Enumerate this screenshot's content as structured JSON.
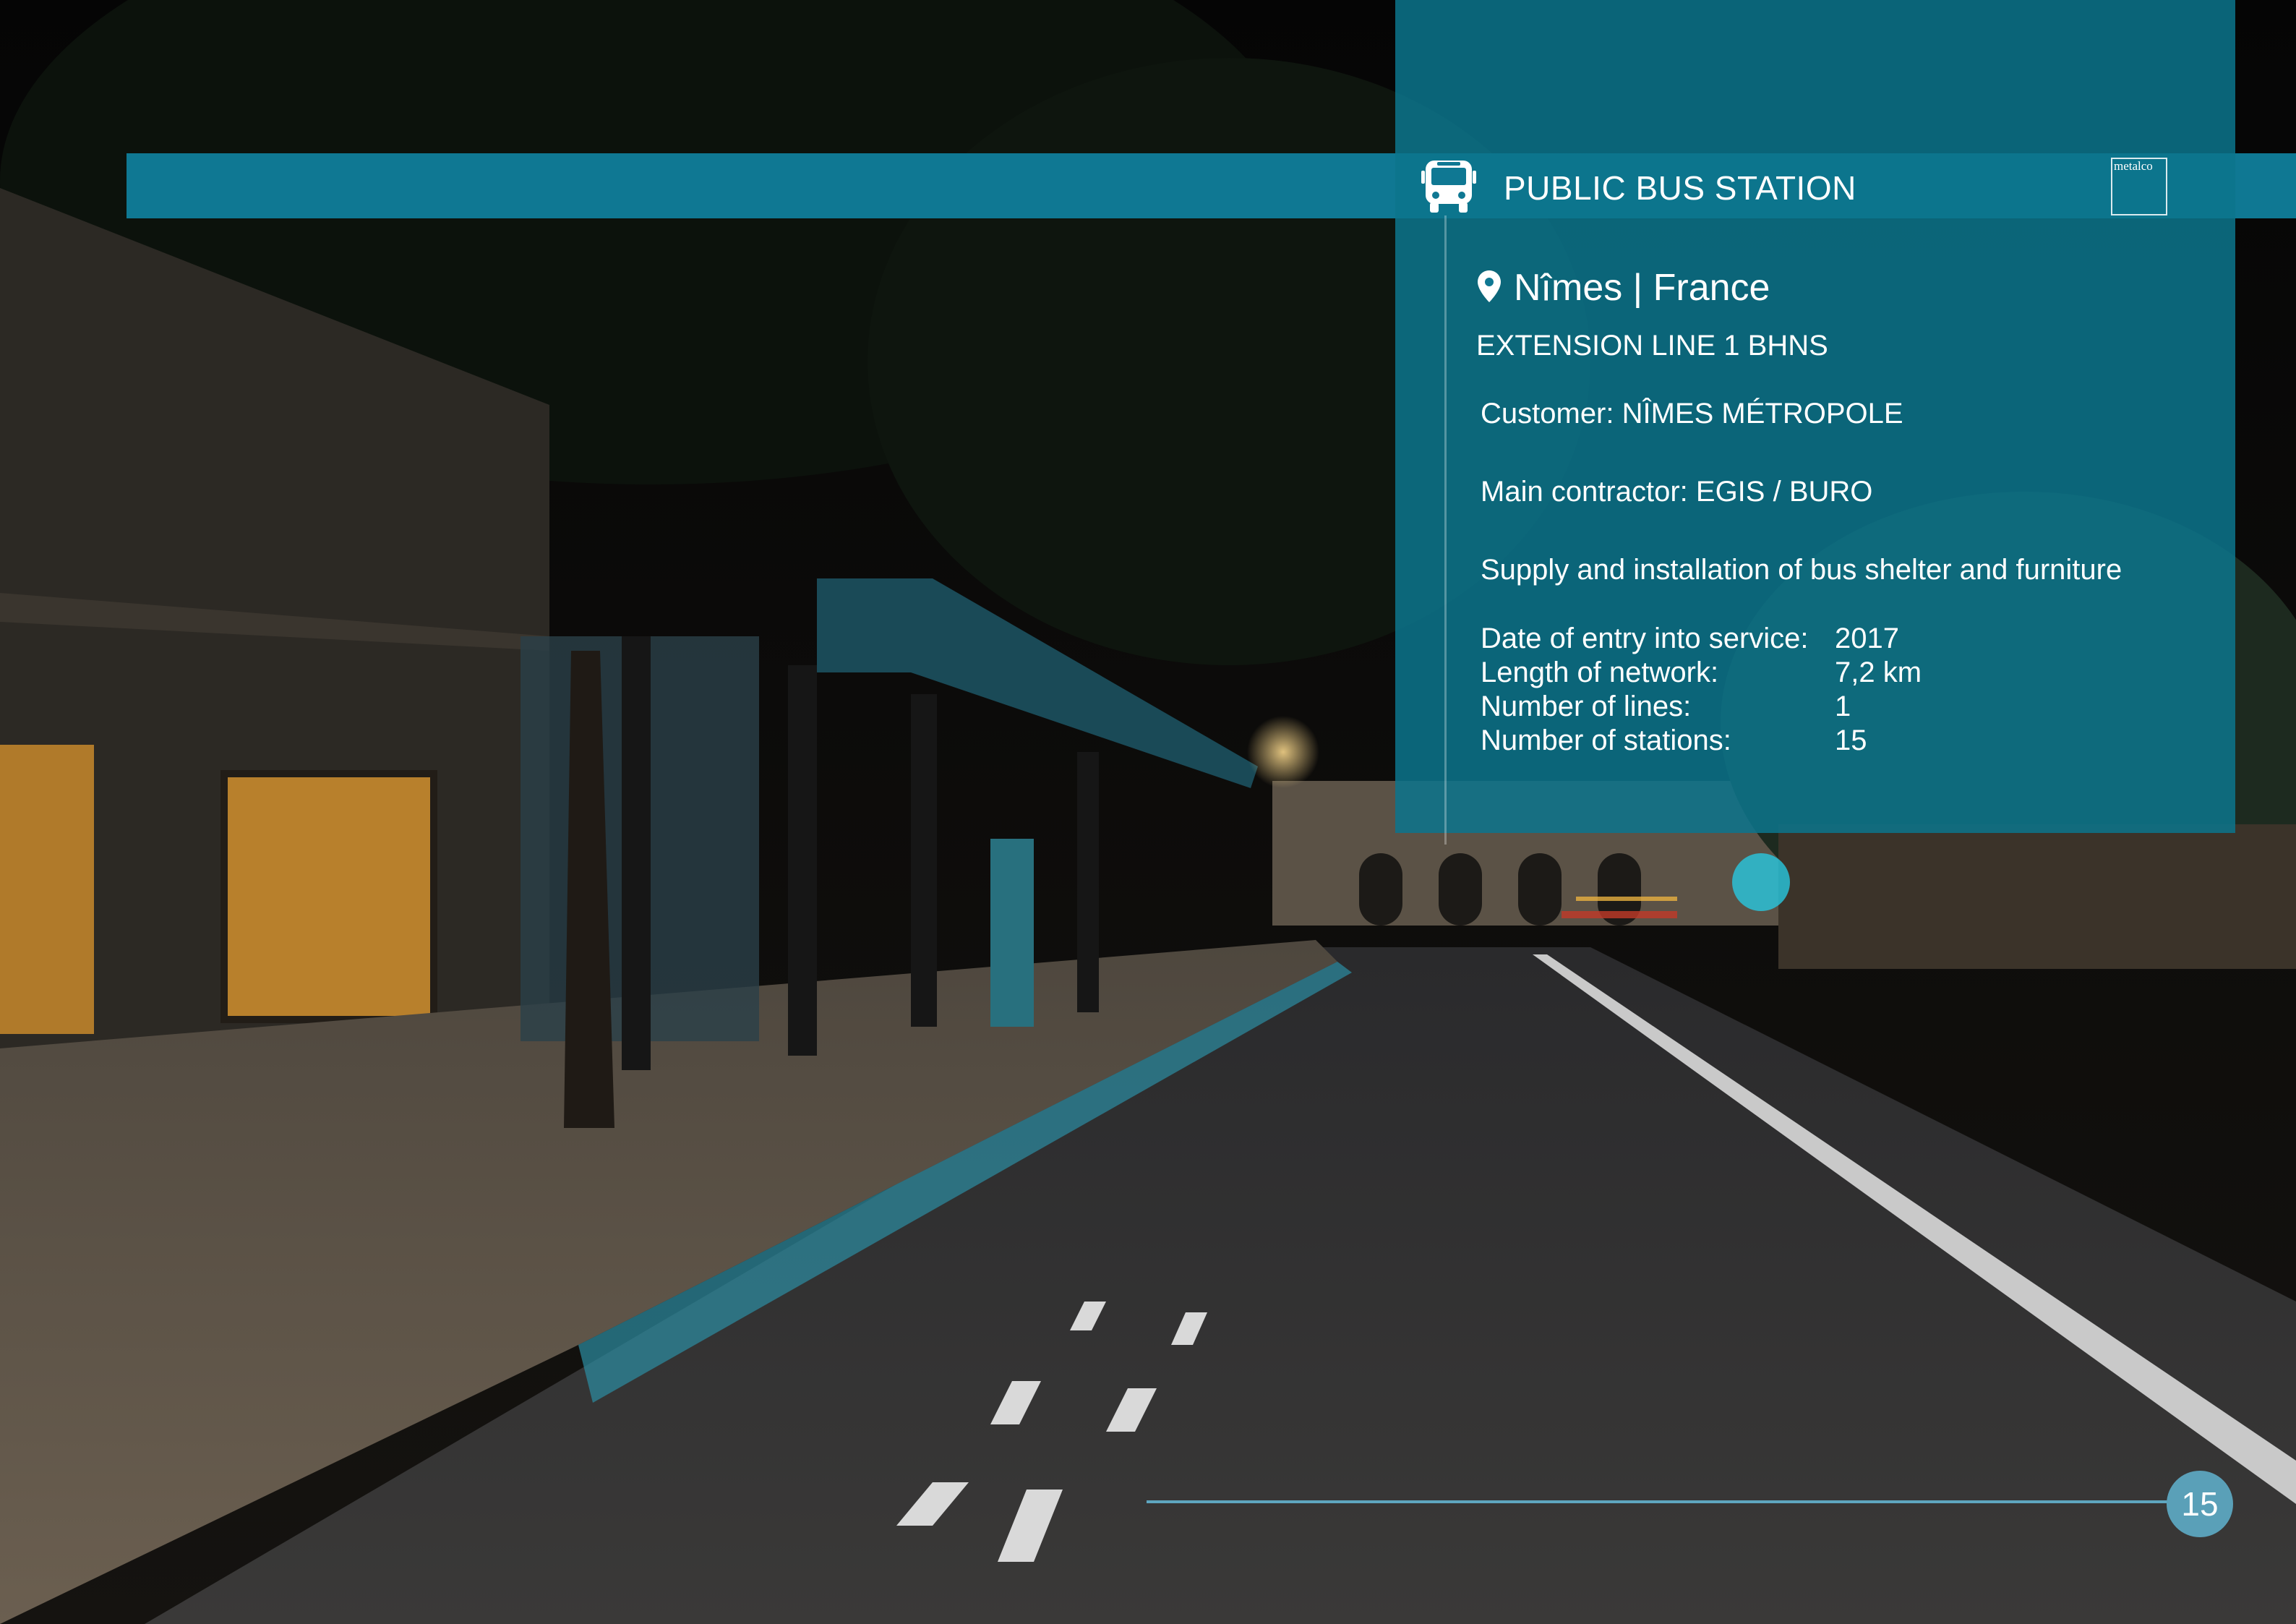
{
  "header": {
    "title": "PUBLIC BUS STATION",
    "icon": "bus-icon",
    "logo_text": "metalco",
    "band_color": "#0f7893"
  },
  "project": {
    "location": "Nîmes | France",
    "location_icon": "map-pin-icon",
    "subtitle": "EXTENSION LINE 1 BHNS",
    "customer": "Customer: NÎMES MÉTROPOLE",
    "contractor": "Main contractor: EGIS / BURO",
    "scope": "Supply and installation of bus shelter and furniture"
  },
  "stats": [
    {
      "label": "Date of entry into service:",
      "value": "2017"
    },
    {
      "label": "Length of network:",
      "value": "7,2 km"
    },
    {
      "label": "Number of lines:",
      "value": "1"
    },
    {
      "label": "Number of stations:",
      "value": "15"
    }
  ],
  "page": {
    "number": "15",
    "accent": "#5aa0b8"
  }
}
